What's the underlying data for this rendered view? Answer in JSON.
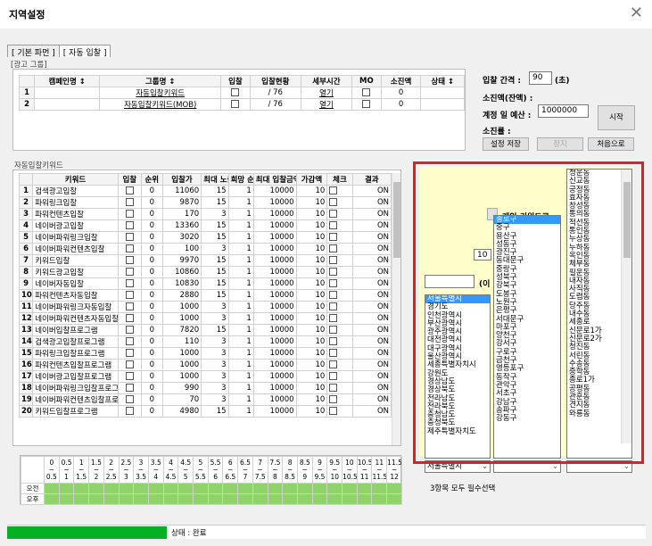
{
  "window": {
    "title": "지역설정",
    "close": "✕"
  },
  "tabs": [
    {
      "label": "[ 기본 파먼 ]"
    },
    {
      "label": "[ 자동 입찰 ]"
    }
  ],
  "ad_group": {
    "label": "[광고 그룹]",
    "headers": [
      "",
      "캠페인명 ↕",
      "그룹명 ↕",
      "입찰",
      "입찰현황",
      "세부시간",
      "MO",
      "소진액",
      "상태 ↕"
    ],
    "rows": [
      {
        "no": "1",
        "campaign": "",
        "group": "자동입찰키워드",
        "status": "/ 76",
        "detail": "열기",
        "spent": "0"
      },
      {
        "no": "2",
        "campaign": "",
        "group": "자동입찰키워드(MOB)",
        "status": "/ 76",
        "detail": "열기",
        "spent": "0"
      }
    ]
  },
  "right_panel": {
    "interval_label": "입찰 간격 :",
    "interval_value": "90",
    "interval_unit": "(초)",
    "spent_label": "소진액(잔액) :",
    "budget_label": "계정 일 예산 :",
    "budget_value": "1000000",
    "spent2_label": "소진률 :",
    "start": "시작",
    "save": "설정 저장",
    "stop": "정지",
    "reset": "처음으로"
  },
  "keywords": {
    "label": "자동입찰키워드",
    "headers": [
      "",
      "키워드",
      "입찰",
      "순위",
      "입찰가",
      "최대 노출",
      "희망 순위",
      "최대 입찰금액",
      "가감액",
      "체크",
      "결과"
    ],
    "rows": [
      {
        "n": "1",
        "kw": "검색광고입찰",
        "rank": "0",
        "bid": "11060",
        "max": "15",
        "hope": "1",
        "maxbid": "10000",
        "adj": "10",
        "res": "ON"
      },
      {
        "n": "2",
        "kw": "파워링크입찰",
        "rank": "0",
        "bid": "9870",
        "max": "15",
        "hope": "1",
        "maxbid": "10000",
        "adj": "10",
        "res": "ON"
      },
      {
        "n": "3",
        "kw": "파워컨텐츠입찰",
        "rank": "0",
        "bid": "170",
        "max": "3",
        "hope": "1",
        "maxbid": "10000",
        "adj": "10",
        "res": "ON"
      },
      {
        "n": "4",
        "kw": "네이버광고입찰",
        "rank": "0",
        "bid": "13360",
        "max": "15",
        "hope": "1",
        "maxbid": "10000",
        "adj": "10",
        "res": "ON"
      },
      {
        "n": "5",
        "kw": "네이버파워링크입찰",
        "rank": "0",
        "bid": "3020",
        "max": "15",
        "hope": "1",
        "maxbid": "10000",
        "adj": "10",
        "res": "ON"
      },
      {
        "n": "6",
        "kw": "네이버파워컨텐츠입찰",
        "rank": "0",
        "bid": "100",
        "max": "3",
        "hope": "1",
        "maxbid": "10000",
        "adj": "10",
        "res": "ON"
      },
      {
        "n": "7",
        "kw": "키워드입찰",
        "rank": "0",
        "bid": "9970",
        "max": "15",
        "hope": "1",
        "maxbid": "10000",
        "adj": "10",
        "res": "ON"
      },
      {
        "n": "8",
        "kw": "키워드광고입찰",
        "rank": "0",
        "bid": "10860",
        "max": "15",
        "hope": "1",
        "maxbid": "10000",
        "adj": "10",
        "res": "ON"
      },
      {
        "n": "9",
        "kw": "네이버자동입찰",
        "rank": "0",
        "bid": "10830",
        "max": "15",
        "hope": "1",
        "maxbid": "10000",
        "adj": "10",
        "res": "ON"
      },
      {
        "n": "10",
        "kw": "파워컨텐츠자동입찰",
        "rank": "0",
        "bid": "2880",
        "max": "15",
        "hope": "1",
        "maxbid": "10000",
        "adj": "10",
        "res": "ON"
      },
      {
        "n": "11",
        "kw": "네이버파워링크자동입찰",
        "rank": "0",
        "bid": "1000",
        "max": "3",
        "hope": "1",
        "maxbid": "10000",
        "adj": "10",
        "res": "ON"
      },
      {
        "n": "12",
        "kw": "네이버파워컨텐츠자동입찰",
        "rank": "0",
        "bid": "1000",
        "max": "3",
        "hope": "1",
        "maxbid": "10000",
        "adj": "10",
        "res": "ON"
      },
      {
        "n": "13",
        "kw": "네이버입찰프로그램",
        "rank": "0",
        "bid": "7820",
        "max": "15",
        "hope": "1",
        "maxbid": "10000",
        "adj": "10",
        "res": "ON"
      },
      {
        "n": "14",
        "kw": "검색광고입찰프로그램",
        "rank": "0",
        "bid": "110",
        "max": "3",
        "hope": "1",
        "maxbid": "10000",
        "adj": "10",
        "res": "ON"
      },
      {
        "n": "15",
        "kw": "파워링크입찰프로그램",
        "rank": "0",
        "bid": "1000",
        "max": "3",
        "hope": "1",
        "maxbid": "10000",
        "adj": "10",
        "res": "ON"
      },
      {
        "n": "16",
        "kw": "파워컨텐츠입찰프로그램",
        "rank": "0",
        "bid": "1000",
        "max": "3",
        "hope": "1",
        "maxbid": "10000",
        "adj": "10",
        "res": "ON"
      },
      {
        "n": "17",
        "kw": "네이버광고입찰프로그램",
        "rank": "0",
        "bid": "1000",
        "max": "3",
        "hope": "1",
        "maxbid": "10000",
        "adj": "10",
        "res": "ON"
      },
      {
        "n": "18",
        "kw": "네이버파워링크입찰프로그램",
        "rank": "0",
        "bid": "990",
        "max": "3",
        "hope": "1",
        "maxbid": "10000",
        "adj": "10",
        "res": "ON"
      },
      {
        "n": "19",
        "kw": "네이버파워컨텐츠입찰프로그램",
        "rank": "0",
        "bid": "70",
        "max": "3",
        "hope": "1",
        "maxbid": "10000",
        "adj": "10",
        "res": "ON"
      },
      {
        "n": "20",
        "kw": "키워드입찰프로그램",
        "rank": "0",
        "bid": "4980",
        "max": "15",
        "hope": "1",
        "maxbid": "10000",
        "adj": "10",
        "res": "ON"
      }
    ]
  },
  "time_grid": {
    "hours": [
      [
        "0",
        "~",
        "0.5"
      ],
      [
        "0.5",
        "~",
        "1"
      ],
      [
        "1",
        "~",
        "1.5"
      ],
      [
        "1.5",
        "~",
        "2"
      ],
      [
        "2",
        "~",
        "2.5"
      ],
      [
        "2.5",
        "~",
        "3"
      ],
      [
        "3",
        "~",
        "3.5"
      ],
      [
        "3.5",
        "~",
        "4"
      ],
      [
        "4",
        "~",
        "4.5"
      ],
      [
        "4.5",
        "~",
        "5"
      ],
      [
        "5",
        "~",
        "5.5"
      ],
      [
        "5.5",
        "~",
        "6"
      ],
      [
        "6",
        "~",
        "6.5"
      ],
      [
        "6.5",
        "~",
        "7"
      ],
      [
        "7",
        "~",
        "7.5"
      ],
      [
        "7.5",
        "~",
        "8"
      ],
      [
        "8",
        "~",
        "8.5"
      ],
      [
        "8.5",
        "~",
        "9"
      ],
      [
        "9",
        "~",
        "9.5"
      ],
      [
        "9.5",
        "~",
        "10"
      ],
      [
        "10",
        "~",
        "10.5"
      ],
      [
        "10.5",
        "~",
        "11"
      ],
      [
        "11",
        "~",
        "11.5"
      ],
      [
        "11.5",
        "~",
        "12"
      ]
    ],
    "rows": [
      "오전",
      "오후"
    ],
    "active_color": "#8fd36a"
  },
  "region": {
    "hidden_label": "개인 키워드로",
    "hidden_btn": "",
    "hidden_val": "10",
    "hidden_paren": "(이",
    "sido_selected": "종로구",
    "sido": [
      "서울특별시",
      "경기도",
      "인천광역시",
      "부산광역시",
      "광주광역시",
      "대전광역시",
      "대구광역시",
      "울산광역시",
      "세종특별자치시",
      "강원도",
      "경상남도",
      "경상북도",
      "전라남도",
      "전라북도",
      "충청남도",
      "충청북도",
      "제주특별자치도"
    ],
    "sido_combo": "서울특별시",
    "gu": [
      "종로구",
      "중구",
      "용산구",
      "성동구",
      "광진구",
      "동대문구",
      "중랑구",
      "성북구",
      "강북구",
      "도봉구",
      "노원구",
      "은평구",
      "서대문구",
      "마포구",
      "양천구",
      "강서구",
      "구로구",
      "금천구",
      "영등포구",
      "동작구",
      "관악구",
      "서초구",
      "강남구",
      "송파구",
      "강동구"
    ],
    "gu_combo": "",
    "dong": [
      "청운동",
      "신교동",
      "궁정동",
      "효자동",
      "창성동",
      "통의동",
      "적선동",
      "통인동",
      "누상동",
      "누하동",
      "옥인동",
      "체부동",
      "필운동",
      "내자동",
      "사직동",
      "도렴동",
      "당주동",
      "내수동",
      "세종로",
      "신문로1가",
      "신문로2가",
      "청진동",
      "서린동",
      "수송동",
      "중학동",
      "종로1가",
      "공평동",
      "관훈동",
      "견지동",
      "와룡동"
    ],
    "dong_combo": "",
    "note": "3항목 모두 필수선택"
  },
  "status": {
    "text": "상태 : 완료",
    "progress": 0.25
  }
}
